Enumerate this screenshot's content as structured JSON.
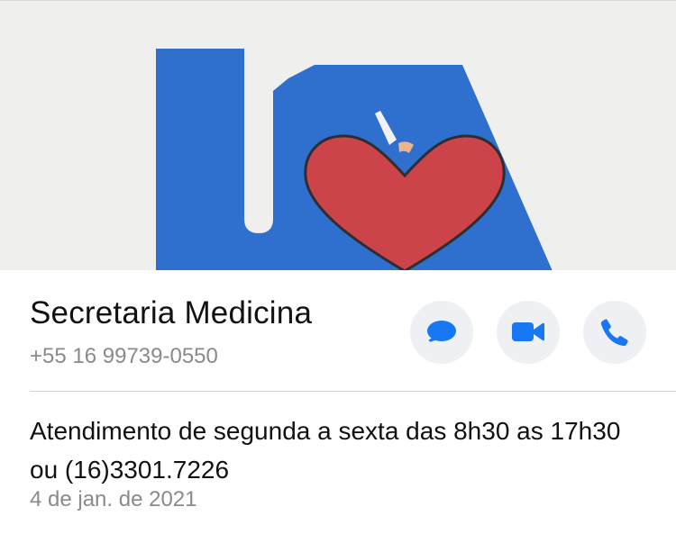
{
  "cover": {
    "icon": "logo-image",
    "colors": {
      "logo_blue": "#2f6fce",
      "heart_red": "#cc4449"
    }
  },
  "contact": {
    "name": "Secretaria Medicina",
    "phone": "+55 16 99739-0550"
  },
  "actions": [
    {
      "icon": "message-icon",
      "color": "#1877f2"
    },
    {
      "icon": "video-camera-icon",
      "color": "#1877f2"
    },
    {
      "icon": "phone-icon",
      "color": "#1877f2"
    }
  ],
  "about": {
    "text": "Atendimento de segunda a sexta das 8h30 as 17h30 ou (16)3301.7226",
    "date": "4 de jan. de 2021"
  }
}
